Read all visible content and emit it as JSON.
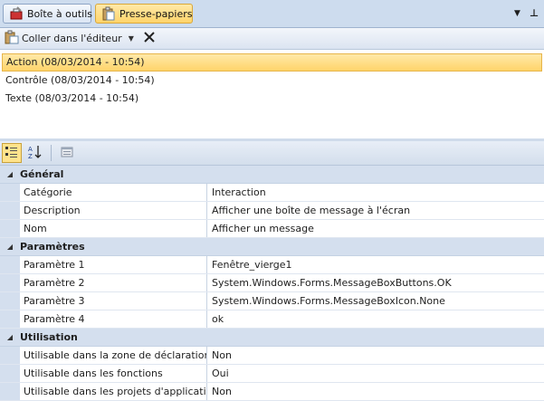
{
  "tabs": [
    {
      "label": "Boîte à outils",
      "icon": "toolbox-icon",
      "active": false
    },
    {
      "label": "Presse-papiers",
      "icon": "clipboard-icon",
      "active": true
    }
  ],
  "window_controls": {
    "dropdown_glyph": "▼",
    "pin_glyph": "⊥"
  },
  "clipboard": {
    "paste_label": "Coller dans l'éditeur",
    "items": [
      {
        "label": "Action (08/03/2014 - 10:54)",
        "selected": true
      },
      {
        "label": "Contrôle (08/03/2014 - 10:54)",
        "selected": false
      },
      {
        "label": "Texte (08/03/2014 - 10:54)",
        "selected": false
      }
    ]
  },
  "property_grid": {
    "toolbar": [
      "categorized-view-icon",
      "alphabetical-sort-icon",
      "property-pages-icon"
    ],
    "categories": [
      {
        "name": "Général",
        "properties": [
          {
            "name": "Catégorie",
            "value": "Interaction"
          },
          {
            "name": "Description",
            "value": "Afficher une boîte de message à l'écran"
          },
          {
            "name": "Nom",
            "value": "Afficher un message"
          }
        ]
      },
      {
        "name": "Paramètres",
        "properties": [
          {
            "name": "Paramètre 1",
            "value": "Fenêtre_vierge1"
          },
          {
            "name": "Paramètre 2",
            "value": "System.Windows.Forms.MessageBoxButtons.OK"
          },
          {
            "name": "Paramètre 3",
            "value": "System.Windows.Forms.MessageBoxIcon.None"
          },
          {
            "name": "Paramètre 4",
            "value": "ok"
          }
        ]
      },
      {
        "name": "Utilisation",
        "properties": [
          {
            "name": "Utilisable dans la zone de déclaration",
            "value": "Non"
          },
          {
            "name": "Utilisable dans les fonctions",
            "value": "Oui"
          },
          {
            "name": "Utilisable dans les projets d'application",
            "value": "Non"
          }
        ]
      }
    ]
  },
  "colors": {
    "accent": "#ffd46a",
    "header_bg": "#d4dfee"
  }
}
